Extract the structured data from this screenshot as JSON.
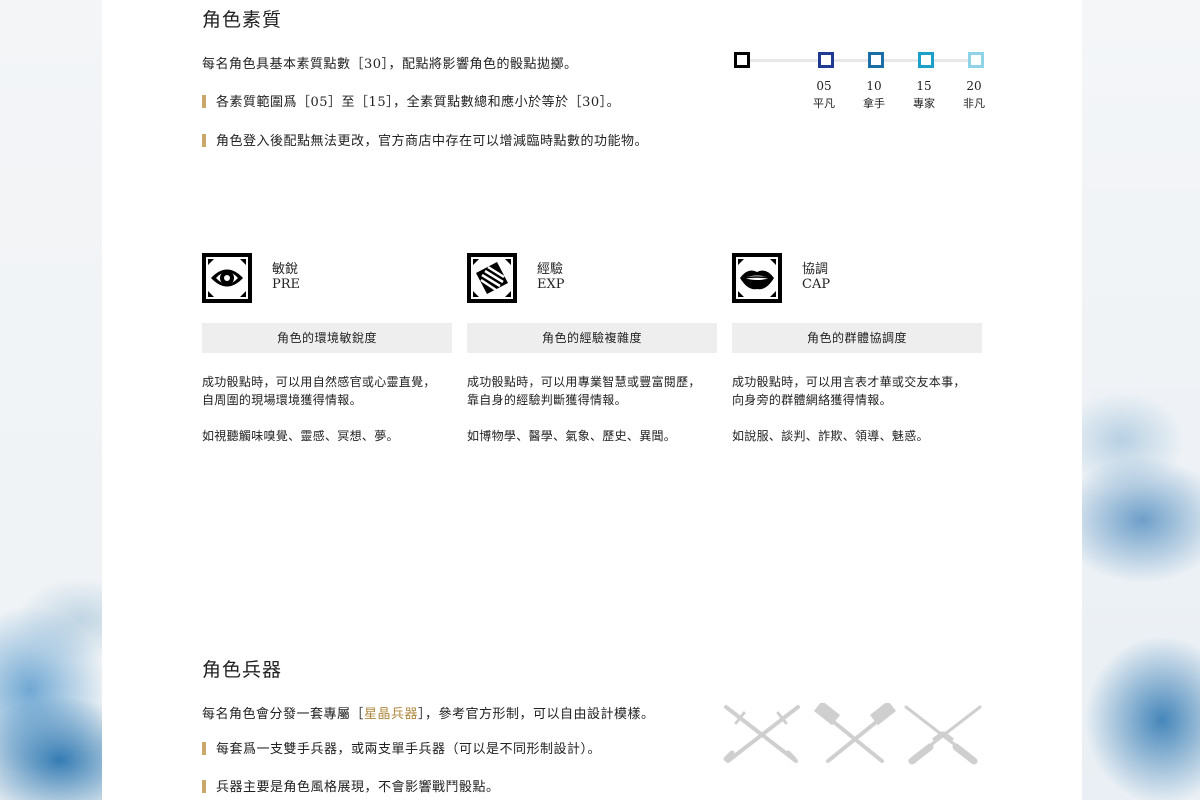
{
  "attributes_section": {
    "title": "角色素質",
    "intro": "每名角色具基本素質點數［30］，配點將影響角色的骰點拋擲。",
    "rule_1": "各素質範圍爲［05］至［15］，全素質點數總和應小於等於［30］。",
    "rule_2": "角色登入後配點無法更改，官方商店中存在可以增減臨時點數的功能物。",
    "scale": {
      "ticks": [
        {
          "value": "",
          "label": "",
          "color": "#000000"
        },
        {
          "value": "05",
          "label": "平凡",
          "color": "#1f3a93"
        },
        {
          "value": "10",
          "label": "拿手",
          "color": "#1c6fa6"
        },
        {
          "value": "15",
          "label": "專家",
          "color": "#1aa0c9"
        },
        {
          "value": "20",
          "label": "非凡",
          "color": "#8fd3e8"
        }
      ]
    }
  },
  "stats": [
    {
      "icon": "eye-icon",
      "name": "敏銳",
      "code": "PRE",
      "subtitle": "角色的環境敏銳度",
      "description": "成功骰點時，可以用自然感官或心靈直覺，\n自周圍的現場環境獲得情報。",
      "examples": "如視聽觸味嗅覺、靈感、冥想、夢。"
    },
    {
      "icon": "scroll-lines-icon",
      "name": "經驗",
      "code": "EXP",
      "subtitle": "角色的經驗複雜度",
      "description": "成功骰點時，可以用專業智慧或豐富閱歷，\n靠自身的經驗判斷獲得情報。",
      "examples": "如博物學、醫學、氣象、歷史、異聞。"
    },
    {
      "icon": "lips-icon",
      "name": "協調",
      "code": "CAP",
      "subtitle": "角色的群體協調度",
      "description": "成功骰點時，可以用言表才華或交友本事，\n向身旁的群體網絡獲得情報。",
      "examples": "如說服、談判、詐欺、領導、魅惑。"
    }
  ],
  "weapons_section": {
    "title": "角色兵器",
    "intro_before": "每名角色會分發一套專屬［",
    "intro_highlight": "星晶兵器",
    "intro_after": "］，參考官方形制，可以自由設計模樣。",
    "rule_1": "每套爲一支雙手兵器，或兩支單手兵器（可以是不同形制設計）。",
    "rule_2": "兵器主要是角色風格展現，不會影響戰鬥骰點。",
    "icons": [
      "crossed-swords-icon",
      "crossed-hammers-icon",
      "crossed-rifles-icon"
    ],
    "highlight_color": "#b0873f"
  }
}
